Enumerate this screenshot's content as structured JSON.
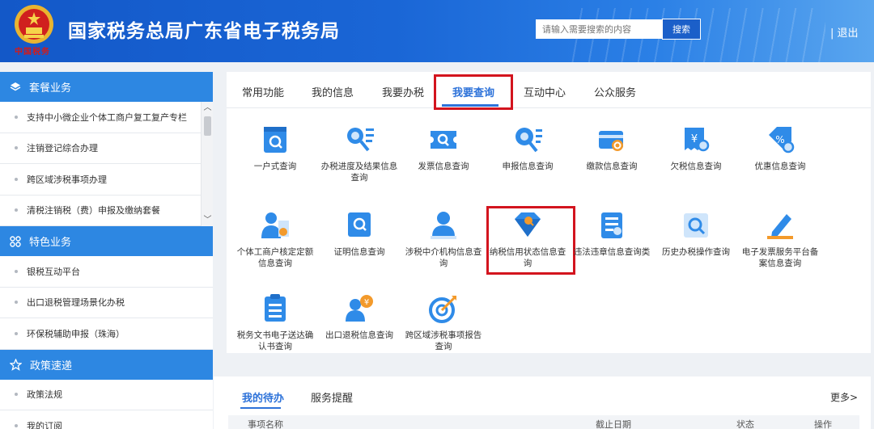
{
  "header": {
    "title": "国家税务总局广东省电子税务局",
    "brand_small": "中国税务",
    "search_placeholder": "请输入需要搜索的内容",
    "search_label": "搜索",
    "logout_label": "| 退出"
  },
  "sidebar": {
    "sections": [
      {
        "title": "套餐业务",
        "icon": "layers-icon",
        "items": [
          "支持中小微企业个体工商户复工复产专栏",
          "注销登记综合办理",
          "跨区域涉税事项办理",
          "清税注销税（费）申报及缴纳套餐"
        ]
      },
      {
        "title": "特色业务",
        "icon": "grid-icon",
        "items": [
          "银税互动平台",
          "出口退税管理场景化办税",
          "环保税辅助申报（珠海）"
        ]
      },
      {
        "title": "政策速递",
        "icon": "star-icon",
        "items": [
          "政策法规",
          "我的订阅"
        ]
      }
    ]
  },
  "tabs": {
    "items": [
      "常用功能",
      "我的信息",
      "我要办税",
      "我要查询",
      "互动中心",
      "公众服务"
    ],
    "active": "我要查询"
  },
  "grid": {
    "items": [
      {
        "label": "一户式查询",
        "icon": "account-search-icon"
      },
      {
        "label": "办税进度及结果信息查询",
        "icon": "progress-search-icon"
      },
      {
        "label": "发票信息查询",
        "icon": "invoice-search-icon"
      },
      {
        "label": "申报信息查询",
        "icon": "declaration-search-icon"
      },
      {
        "label": "缴款信息查询",
        "icon": "payment-card-icon"
      },
      {
        "label": "欠税信息查询",
        "icon": "arrears-yuan-icon"
      },
      {
        "label": "优惠信息查询",
        "icon": "discount-percent-icon"
      },
      {
        "label": "个体工商户核定定额信息查询",
        "icon": "business-person-icon"
      },
      {
        "label": "证明信息查询",
        "icon": "certificate-search-icon"
      },
      {
        "label": "涉税中介机构信息查询",
        "icon": "agency-person-icon"
      },
      {
        "label": "纳税信用状态信息查询",
        "icon": "credit-diamond-icon"
      },
      {
        "label": "违法违章信息查询类",
        "icon": "violation-document-icon"
      },
      {
        "label": "历史办税操作查询",
        "icon": "history-search-icon"
      },
      {
        "label": "电子发票服务平台备案信息查询",
        "icon": "pen-edit-icon"
      },
      {
        "label": "税务文书电子送达确认书查询",
        "icon": "tax-document-icon"
      },
      {
        "label": "出口退税信息查询",
        "icon": "export-refund-icon"
      },
      {
        "label": "跨区域涉税事项报告查询",
        "icon": "target-arrow-icon"
      }
    ]
  },
  "todo": {
    "tabs": [
      "我的待办",
      "服务提醒"
    ],
    "more_label": "更多>",
    "columns": [
      "事项名称",
      "截止日期",
      "状态",
      "操作"
    ]
  },
  "colors": {
    "header_blue": "#1a66d6",
    "accent_blue": "#2d72d9",
    "section_blue": "#2d87e2",
    "highlight_red": "#d3141e",
    "icon_blue": "#2f8be8",
    "icon_light": "#cfe5fb"
  }
}
